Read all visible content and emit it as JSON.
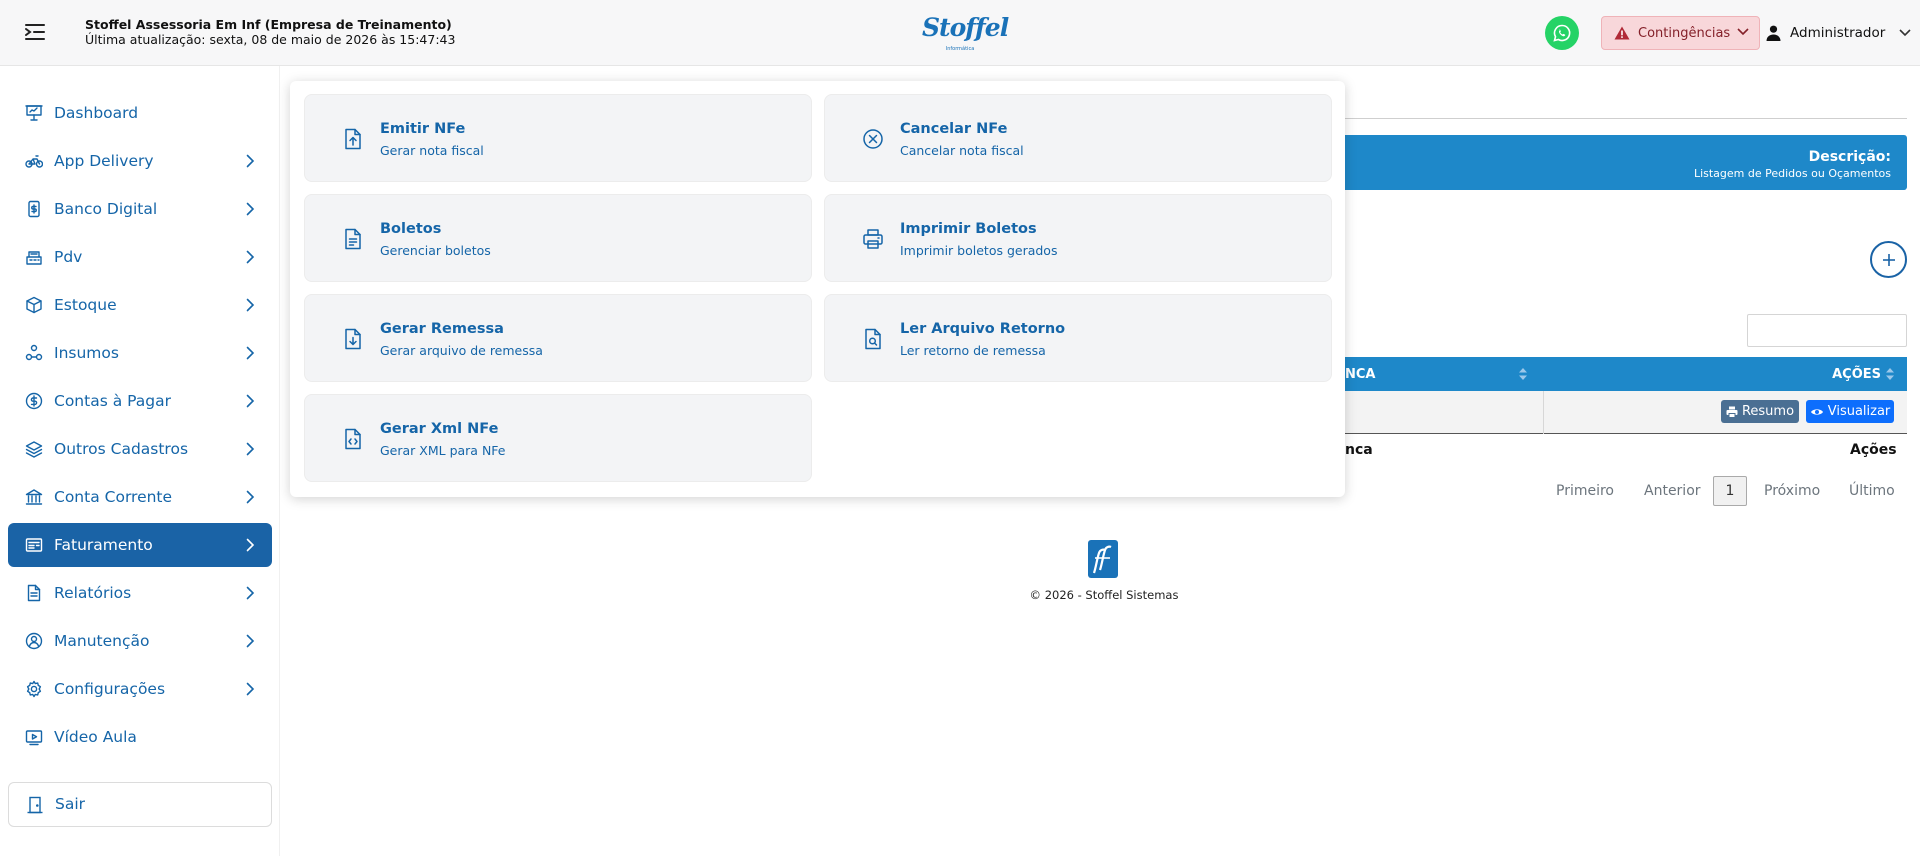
{
  "header": {
    "company_name": "Stoffel Assessoria Em Inf (Empresa de Treinamento)",
    "last_update": "Última atualização: sexta, 08 de maio de 2026 às 15:47:43",
    "logo_text": "Stoffel",
    "logo_subtext": "Informática",
    "contingencias_label": "Contingências",
    "user_label": "Administrador",
    "whatsapp_color": "#25d366",
    "accent_color": "#1a63a6"
  },
  "sidebar": {
    "items": [
      {
        "label": "Dashboard",
        "icon": "dashboard-icon",
        "has_arrow": false
      },
      {
        "label": "App Delivery",
        "icon": "motorcycle-icon",
        "has_arrow": true
      },
      {
        "label": "Banco Digital",
        "icon": "digital-wallet-icon",
        "has_arrow": true
      },
      {
        "label": "Pdv",
        "icon": "register-icon",
        "has_arrow": true
      },
      {
        "label": "Estoque",
        "icon": "box-icon",
        "has_arrow": true
      },
      {
        "label": "Insumos",
        "icon": "nodes-icon",
        "has_arrow": true
      },
      {
        "label": "Contas à Pagar",
        "icon": "dollar-icon",
        "has_arrow": true
      },
      {
        "label": "Outros Cadastros",
        "icon": "layers-icon",
        "has_arrow": true
      },
      {
        "label": "Conta Corrente",
        "icon": "bank-icon",
        "has_arrow": true
      },
      {
        "label": "Faturamento",
        "icon": "invoice-icon",
        "has_arrow": true,
        "active": true
      },
      {
        "label": "Relatórios",
        "icon": "report-icon",
        "has_arrow": true
      },
      {
        "label": "Manutenção",
        "icon": "maintenance-icon",
        "has_arrow": true
      },
      {
        "label": "Configurações",
        "icon": "gear-icon",
        "has_arrow": true
      },
      {
        "label": "Vídeo Aula",
        "icon": "video-icon",
        "has_arrow": false
      }
    ],
    "logout_label": "Sair"
  },
  "menu_panel": {
    "cards": [
      {
        "title": "Emitir NFe",
        "desc": "Gerar nota fiscal",
        "icon": "upload-file-icon"
      },
      {
        "title": "Cancelar NFe",
        "desc": "Cancelar nota fiscal",
        "icon": "cancel-circle-icon"
      },
      {
        "title": "Boletos",
        "desc": "Gerenciar boletos",
        "icon": "document-icon"
      },
      {
        "title": "Imprimir Boletos",
        "desc": "Imprimir boletos gerados",
        "icon": "printer-icon"
      },
      {
        "title": "Gerar Remessa",
        "desc": "Gerar arquivo de remessa",
        "icon": "download-file-icon"
      },
      {
        "title": "Ler Arquivo Retorno",
        "desc": "Ler retorno de remessa",
        "icon": "search-file-icon"
      },
      {
        "title": "Gerar Xml NFe",
        "desc": "Gerar XML para NFe",
        "icon": "code-file-icon"
      }
    ]
  },
  "page": {
    "description_title": "Descrição:",
    "description_text": "Listagem de Pedidos ou Oçamentos",
    "table_header_partial": "NCA",
    "table_actions_header": "AÇÕES",
    "btn_resumo": "Resumo",
    "btn_visualizar": "Visualizar",
    "footer_partial": "nca",
    "footer_actions": "Ações",
    "pagination": {
      "first": "Primeiro",
      "previous": "Anterior",
      "current": "1",
      "next": "Próximo",
      "last": "Último"
    },
    "copyright": "© 2026 - Stoffel Sistemas"
  }
}
